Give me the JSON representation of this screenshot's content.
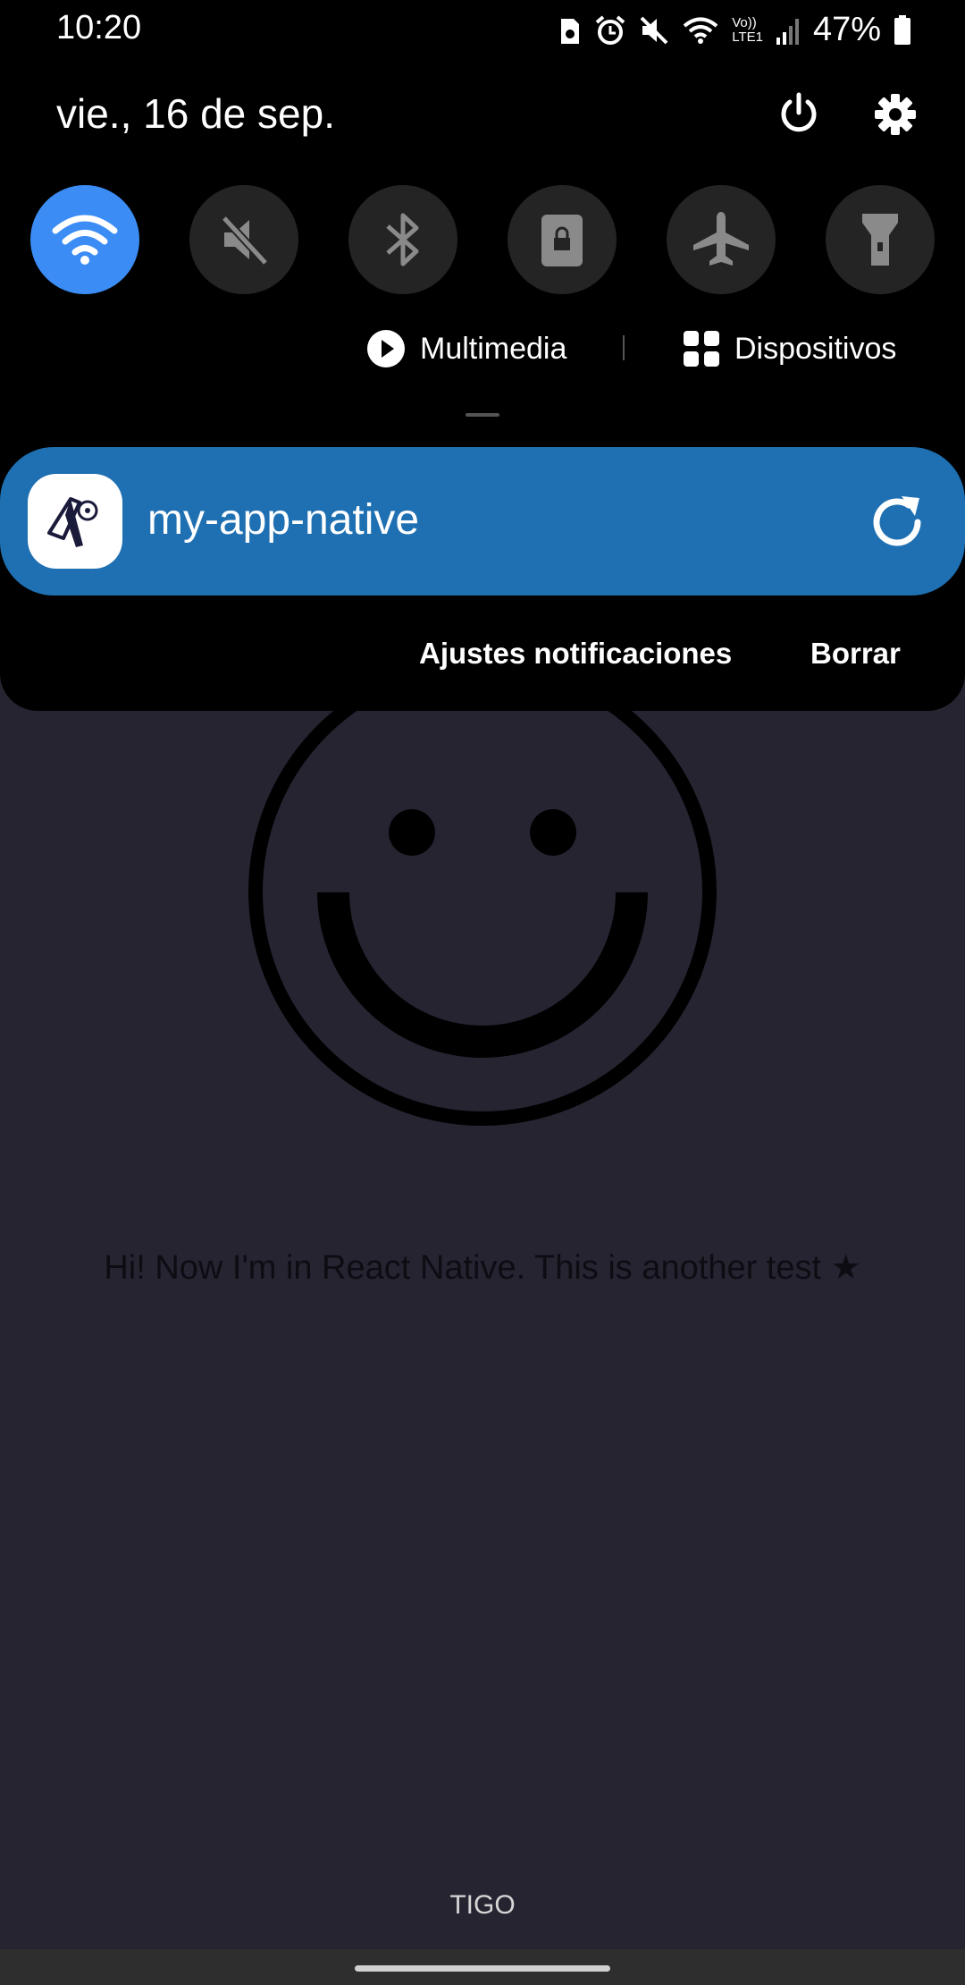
{
  "status_bar": {
    "time": "10:20",
    "battery_percent": "47%",
    "network_label_top": "Vo))",
    "network_label_bottom": "LTE1",
    "icons": [
      "storage-icon",
      "alarm-icon",
      "mute-icon",
      "wifi-icon",
      "signal-icon",
      "battery-icon"
    ]
  },
  "header": {
    "date": "vie., 16 de sep.",
    "power_icon": "power-icon",
    "settings_icon": "gear-icon"
  },
  "quick_settings": [
    {
      "name": "wifi",
      "active": true
    },
    {
      "name": "sound",
      "active": false
    },
    {
      "name": "bluetooth",
      "active": false
    },
    {
      "name": "screen-lock",
      "active": false
    },
    {
      "name": "airplane-mode",
      "active": false
    },
    {
      "name": "flashlight",
      "active": false
    }
  ],
  "media_row": {
    "multimedia_label": "Multimedia",
    "devices_label": "Dispositivos"
  },
  "notification": {
    "app_name": "my-app-native",
    "settings_action": "Ajustes notificaciones",
    "clear_action": "Borrar"
  },
  "app_content": {
    "message": "Hi! Now I'm in React Native. This is another test ★"
  },
  "footer": {
    "carrier": "TIGO"
  },
  "colors": {
    "accent": "#3b8df5",
    "notification_bg": "#1f70b2",
    "app_bg": "#272432"
  }
}
